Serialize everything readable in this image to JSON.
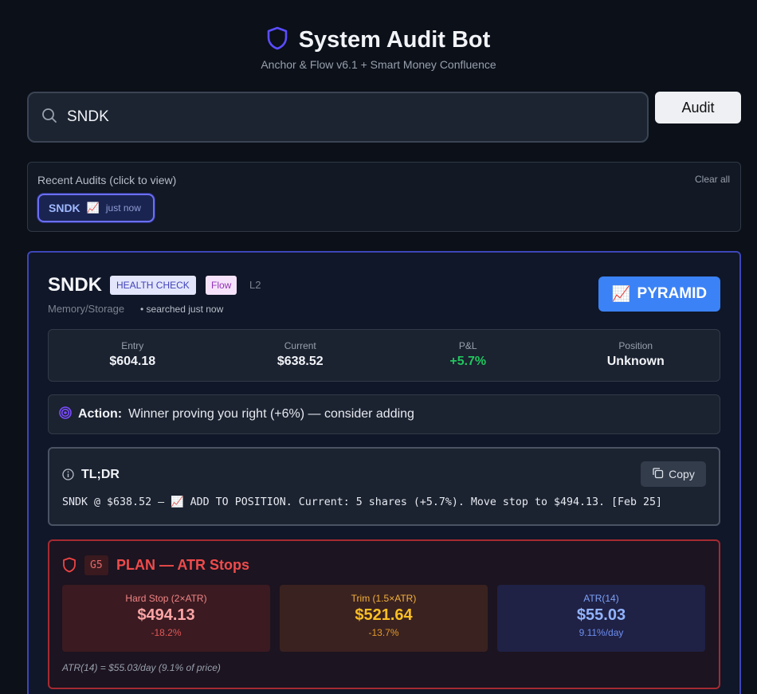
{
  "app": {
    "title": "System Audit Bot",
    "subtitle": "Anchor & Flow v6.1 + Smart Money Confluence",
    "accent": "#5b4dff"
  },
  "search": {
    "value": "SNDK",
    "placeholder": ""
  },
  "audit_button": {
    "label": "Audit"
  },
  "recent": {
    "label": "Recent Audits (click to view)",
    "clear_label": "Clear all",
    "items": [
      {
        "ticker": "SNDK",
        "icon": "chart-up-icon",
        "emoji": "📈",
        "time": "just now"
      }
    ]
  },
  "result": {
    "ticker": "SNDK",
    "badge_health": "HEALTH CHECK",
    "badge_flow": "Flow",
    "level": "L2",
    "sector": "Memory/Storage",
    "searched": "• searched just now",
    "signal": {
      "emoji": "📈",
      "label": "PYRAMID",
      "color": "#3b82f6"
    },
    "stats": [
      {
        "label": "Entry",
        "value": "$604.18"
      },
      {
        "label": "Current",
        "value": "$638.52"
      },
      {
        "label": "P&L",
        "value": "+5.7%"
      },
      {
        "label": "Position",
        "value": "Unknown"
      }
    ],
    "action": {
      "label": "Action:",
      "text": "Winner proving you right (+6%) — consider adding"
    },
    "tldr": {
      "title": "TL;DR",
      "copy_label": "Copy",
      "text": "SNDK @ $638.52 — 📈 ADD TO POSITION. Current: 5 shares (+5.7%). Move stop to $494.13. [Feb 25]"
    },
    "plan": {
      "gate": "G5",
      "title": "PLAN — ATR Stops",
      "boxes": [
        {
          "label": "Hard Stop (2×ATR)",
          "value": "$494.13",
          "sub": "-18.2%"
        },
        {
          "label": "Trim (1.5×ATR)",
          "value": "$521.64",
          "sub": "-13.7%"
        },
        {
          "label": "ATR(14)",
          "value": "$55.03",
          "sub": "9.11%/day"
        }
      ],
      "footnote": "ATR(14) = $55.03/day (9.1% of price)"
    }
  }
}
